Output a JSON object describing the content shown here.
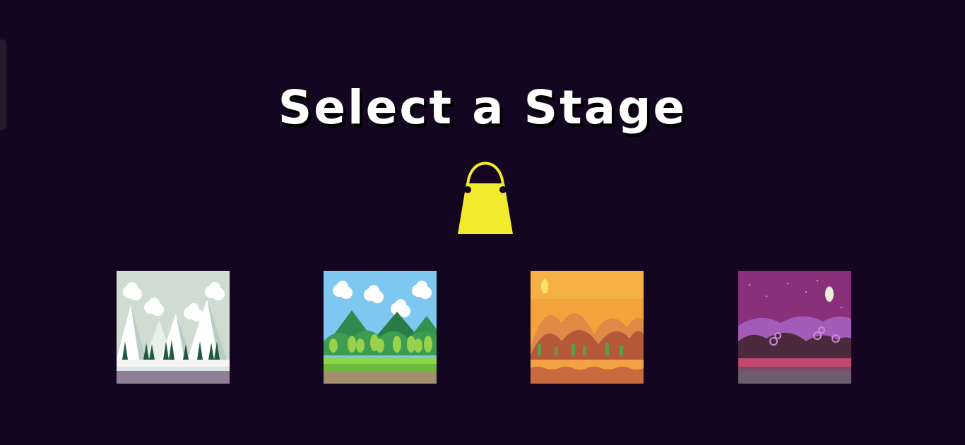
{
  "screen": {
    "title": "Select a Stage",
    "background": "#140620"
  },
  "shop_button": {
    "icon": "shopping-bag-icon",
    "color": "#f2ea2c"
  },
  "stages": [
    {
      "theme": "snow",
      "icon": "snowy-mountains-stage-thumbnail"
    },
    {
      "theme": "forest",
      "icon": "green-forest-stage-thumbnail"
    },
    {
      "theme": "desert",
      "icon": "desert-sunset-stage-thumbnail"
    },
    {
      "theme": "night",
      "icon": "purple-night-stage-thumbnail"
    }
  ]
}
